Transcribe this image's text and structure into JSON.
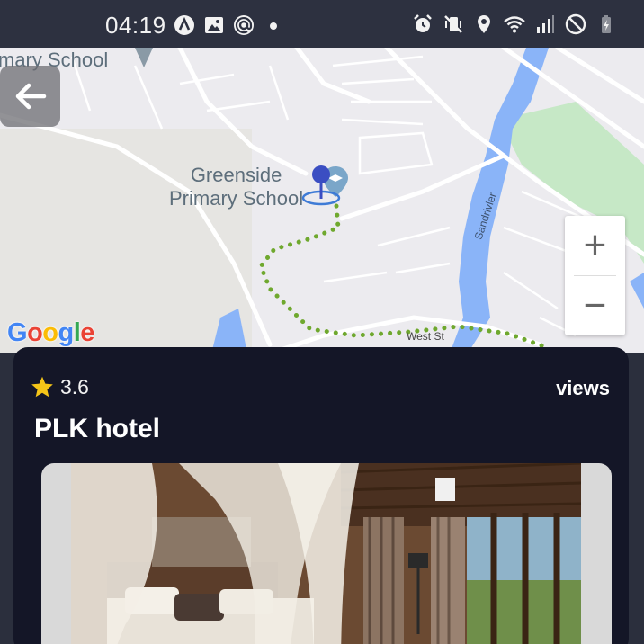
{
  "status_bar": {
    "time": "04:19",
    "left_icons": [
      "a-circle-icon",
      "image-icon",
      "at-sign-icon",
      "dot-icon"
    ],
    "right_icons": [
      "alarm-icon",
      "vibrate-off-icon",
      "location-icon",
      "wifi-icon",
      "signal-icon",
      "do-not-disturb-icon",
      "battery-icon"
    ]
  },
  "map": {
    "labels": {
      "school_top": "mary School",
      "school_main_line1": "Greenside",
      "school_main_line2": "Primary School",
      "street": "West St",
      "river": "Sandrivier"
    },
    "google_logo": "Google",
    "zoom_in": "+",
    "zoom_out": "−",
    "colors": {
      "land": "#ecebef",
      "water": "#8ab4f8",
      "park": "#c6e8c6",
      "route": "#6fa82e",
      "pin": "#3b4ec2"
    }
  },
  "card": {
    "rating": "3.6",
    "views_label": "views",
    "hotel_name": "PLK hotel",
    "star_color": "#f5c518"
  }
}
